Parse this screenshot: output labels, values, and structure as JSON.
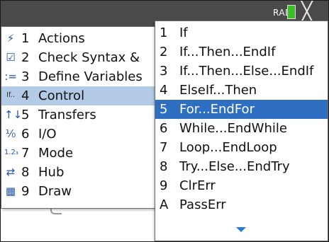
{
  "status": {
    "angle_mode": "RAD",
    "close_glyph": "╳"
  },
  "main_menu": {
    "items": [
      {
        "icon_name": "actions-lightning-icon",
        "icon": "⚡",
        "num": "1",
        "label": "Actions",
        "has_submenu": true
      },
      {
        "icon_name": "check-syntax-icon",
        "icon": "☑",
        "num": "2",
        "label": "Check Syntax &"
      },
      {
        "icon_name": "define-variables-icon",
        "icon": ":=",
        "num": "3",
        "label": "Define Variables"
      },
      {
        "icon_name": "control-if-icon",
        "icon": "If..",
        "num": "4",
        "label": "Control",
        "selected": true
      },
      {
        "icon_name": "transfers-arrows-icon",
        "icon": "↑↓",
        "num": "5",
        "label": "Transfers"
      },
      {
        "icon_name": "io-fraction-icon",
        "icon": "⅟₀",
        "num": "6",
        "label": "I/O"
      },
      {
        "icon_name": "mode-123-icon",
        "icon": "1.2₃",
        "num": "7",
        "label": "Mode"
      },
      {
        "icon_name": "hub-arrows-icon",
        "icon": "⇄",
        "num": "8",
        "label": "Hub"
      },
      {
        "icon_name": "draw-grid-icon",
        "icon": "▦",
        "num": "9",
        "label": "Draw"
      }
    ]
  },
  "control_submenu": {
    "items": [
      {
        "num": "1",
        "label": "If"
      },
      {
        "num": "2",
        "label": "If...Then...EndIf"
      },
      {
        "num": "3",
        "label": "If...Then...Else...EndIf"
      },
      {
        "num": "4",
        "label": "ElseIf...Then"
      },
      {
        "num": "5",
        "label": "For...EndFor",
        "selected": true
      },
      {
        "num": "6",
        "label": "While...EndWhile"
      },
      {
        "num": "7",
        "label": "Loop...EndLoop"
      },
      {
        "num": "8",
        "label": "Try...Else...EndTry"
      },
      {
        "num": "9",
        "label": "ClrErr"
      },
      {
        "num": "A",
        "label": "PassErr"
      }
    ],
    "scroll_indicator": "more-below-arrow"
  },
  "colors": {
    "title_bar": "#4a4a4a",
    "menu_highlight": "#b3cbe6",
    "submenu_highlight": "#2f6fc2",
    "battery": "#3cbf2a",
    "scroll_arrow": "#2b78d6"
  }
}
